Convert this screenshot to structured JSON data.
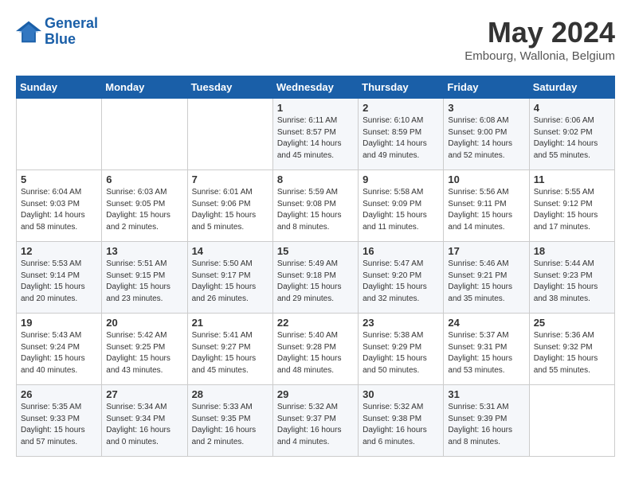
{
  "header": {
    "logo_line1": "General",
    "logo_line2": "Blue",
    "month": "May 2024",
    "location": "Embourg, Wallonia, Belgium"
  },
  "days_of_week": [
    "Sunday",
    "Monday",
    "Tuesday",
    "Wednesday",
    "Thursday",
    "Friday",
    "Saturday"
  ],
  "weeks": [
    [
      {
        "day": "",
        "info": ""
      },
      {
        "day": "",
        "info": ""
      },
      {
        "day": "",
        "info": ""
      },
      {
        "day": "1",
        "info": "Sunrise: 6:11 AM\nSunset: 8:57 PM\nDaylight: 14 hours\nand 45 minutes."
      },
      {
        "day": "2",
        "info": "Sunrise: 6:10 AM\nSunset: 8:59 PM\nDaylight: 14 hours\nand 49 minutes."
      },
      {
        "day": "3",
        "info": "Sunrise: 6:08 AM\nSunset: 9:00 PM\nDaylight: 14 hours\nand 52 minutes."
      },
      {
        "day": "4",
        "info": "Sunrise: 6:06 AM\nSunset: 9:02 PM\nDaylight: 14 hours\nand 55 minutes."
      }
    ],
    [
      {
        "day": "5",
        "info": "Sunrise: 6:04 AM\nSunset: 9:03 PM\nDaylight: 14 hours\nand 58 minutes."
      },
      {
        "day": "6",
        "info": "Sunrise: 6:03 AM\nSunset: 9:05 PM\nDaylight: 15 hours\nand 2 minutes."
      },
      {
        "day": "7",
        "info": "Sunrise: 6:01 AM\nSunset: 9:06 PM\nDaylight: 15 hours\nand 5 minutes."
      },
      {
        "day": "8",
        "info": "Sunrise: 5:59 AM\nSunset: 9:08 PM\nDaylight: 15 hours\nand 8 minutes."
      },
      {
        "day": "9",
        "info": "Sunrise: 5:58 AM\nSunset: 9:09 PM\nDaylight: 15 hours\nand 11 minutes."
      },
      {
        "day": "10",
        "info": "Sunrise: 5:56 AM\nSunset: 9:11 PM\nDaylight: 15 hours\nand 14 minutes."
      },
      {
        "day": "11",
        "info": "Sunrise: 5:55 AM\nSunset: 9:12 PM\nDaylight: 15 hours\nand 17 minutes."
      }
    ],
    [
      {
        "day": "12",
        "info": "Sunrise: 5:53 AM\nSunset: 9:14 PM\nDaylight: 15 hours\nand 20 minutes."
      },
      {
        "day": "13",
        "info": "Sunrise: 5:51 AM\nSunset: 9:15 PM\nDaylight: 15 hours\nand 23 minutes."
      },
      {
        "day": "14",
        "info": "Sunrise: 5:50 AM\nSunset: 9:17 PM\nDaylight: 15 hours\nand 26 minutes."
      },
      {
        "day": "15",
        "info": "Sunrise: 5:49 AM\nSunset: 9:18 PM\nDaylight: 15 hours\nand 29 minutes."
      },
      {
        "day": "16",
        "info": "Sunrise: 5:47 AM\nSunset: 9:20 PM\nDaylight: 15 hours\nand 32 minutes."
      },
      {
        "day": "17",
        "info": "Sunrise: 5:46 AM\nSunset: 9:21 PM\nDaylight: 15 hours\nand 35 minutes."
      },
      {
        "day": "18",
        "info": "Sunrise: 5:44 AM\nSunset: 9:23 PM\nDaylight: 15 hours\nand 38 minutes."
      }
    ],
    [
      {
        "day": "19",
        "info": "Sunrise: 5:43 AM\nSunset: 9:24 PM\nDaylight: 15 hours\nand 40 minutes."
      },
      {
        "day": "20",
        "info": "Sunrise: 5:42 AM\nSunset: 9:25 PM\nDaylight: 15 hours\nand 43 minutes."
      },
      {
        "day": "21",
        "info": "Sunrise: 5:41 AM\nSunset: 9:27 PM\nDaylight: 15 hours\nand 45 minutes."
      },
      {
        "day": "22",
        "info": "Sunrise: 5:40 AM\nSunset: 9:28 PM\nDaylight: 15 hours\nand 48 minutes."
      },
      {
        "day": "23",
        "info": "Sunrise: 5:38 AM\nSunset: 9:29 PM\nDaylight: 15 hours\nand 50 minutes."
      },
      {
        "day": "24",
        "info": "Sunrise: 5:37 AM\nSunset: 9:31 PM\nDaylight: 15 hours\nand 53 minutes."
      },
      {
        "day": "25",
        "info": "Sunrise: 5:36 AM\nSunset: 9:32 PM\nDaylight: 15 hours\nand 55 minutes."
      }
    ],
    [
      {
        "day": "26",
        "info": "Sunrise: 5:35 AM\nSunset: 9:33 PM\nDaylight: 15 hours\nand 57 minutes."
      },
      {
        "day": "27",
        "info": "Sunrise: 5:34 AM\nSunset: 9:34 PM\nDaylight: 16 hours\nand 0 minutes."
      },
      {
        "day": "28",
        "info": "Sunrise: 5:33 AM\nSunset: 9:35 PM\nDaylight: 16 hours\nand 2 minutes."
      },
      {
        "day": "29",
        "info": "Sunrise: 5:32 AM\nSunset: 9:37 PM\nDaylight: 16 hours\nand 4 minutes."
      },
      {
        "day": "30",
        "info": "Sunrise: 5:32 AM\nSunset: 9:38 PM\nDaylight: 16 hours\nand 6 minutes."
      },
      {
        "day": "31",
        "info": "Sunrise: 5:31 AM\nSunset: 9:39 PM\nDaylight: 16 hours\nand 8 minutes."
      },
      {
        "day": "",
        "info": ""
      }
    ]
  ]
}
